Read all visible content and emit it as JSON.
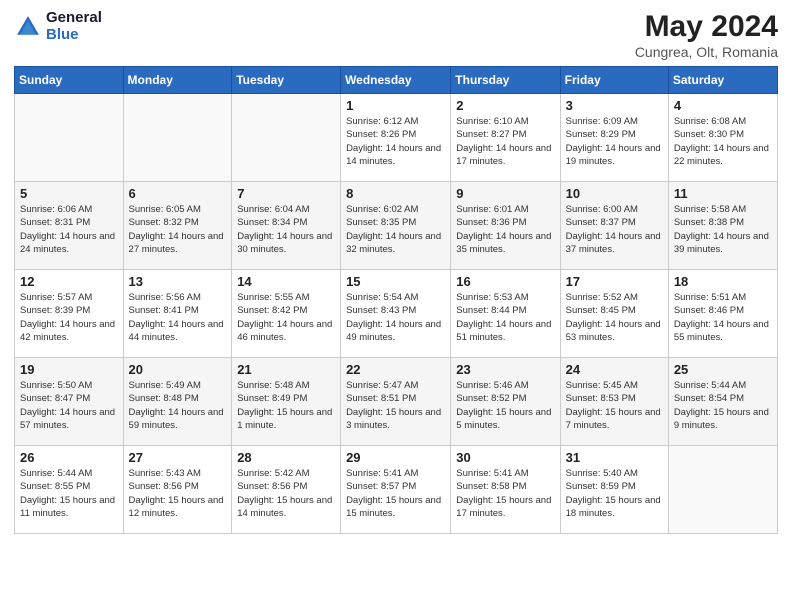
{
  "logo": {
    "general": "General",
    "blue": "Blue"
  },
  "title": "May 2024",
  "subtitle": "Cungrea, Olt, Romania",
  "days_header": [
    "Sunday",
    "Monday",
    "Tuesday",
    "Wednesday",
    "Thursday",
    "Friday",
    "Saturday"
  ],
  "weeks": [
    [
      {
        "day": "",
        "info": ""
      },
      {
        "day": "",
        "info": ""
      },
      {
        "day": "",
        "info": ""
      },
      {
        "day": "1",
        "info": "Sunrise: 6:12 AM\nSunset: 8:26 PM\nDaylight: 14 hours and 14 minutes."
      },
      {
        "day": "2",
        "info": "Sunrise: 6:10 AM\nSunset: 8:27 PM\nDaylight: 14 hours and 17 minutes."
      },
      {
        "day": "3",
        "info": "Sunrise: 6:09 AM\nSunset: 8:29 PM\nDaylight: 14 hours and 19 minutes."
      },
      {
        "day": "4",
        "info": "Sunrise: 6:08 AM\nSunset: 8:30 PM\nDaylight: 14 hours and 22 minutes."
      }
    ],
    [
      {
        "day": "5",
        "info": "Sunrise: 6:06 AM\nSunset: 8:31 PM\nDaylight: 14 hours and 24 minutes."
      },
      {
        "day": "6",
        "info": "Sunrise: 6:05 AM\nSunset: 8:32 PM\nDaylight: 14 hours and 27 minutes."
      },
      {
        "day": "7",
        "info": "Sunrise: 6:04 AM\nSunset: 8:34 PM\nDaylight: 14 hours and 30 minutes."
      },
      {
        "day": "8",
        "info": "Sunrise: 6:02 AM\nSunset: 8:35 PM\nDaylight: 14 hours and 32 minutes."
      },
      {
        "day": "9",
        "info": "Sunrise: 6:01 AM\nSunset: 8:36 PM\nDaylight: 14 hours and 35 minutes."
      },
      {
        "day": "10",
        "info": "Sunrise: 6:00 AM\nSunset: 8:37 PM\nDaylight: 14 hours and 37 minutes."
      },
      {
        "day": "11",
        "info": "Sunrise: 5:58 AM\nSunset: 8:38 PM\nDaylight: 14 hours and 39 minutes."
      }
    ],
    [
      {
        "day": "12",
        "info": "Sunrise: 5:57 AM\nSunset: 8:39 PM\nDaylight: 14 hours and 42 minutes."
      },
      {
        "day": "13",
        "info": "Sunrise: 5:56 AM\nSunset: 8:41 PM\nDaylight: 14 hours and 44 minutes."
      },
      {
        "day": "14",
        "info": "Sunrise: 5:55 AM\nSunset: 8:42 PM\nDaylight: 14 hours and 46 minutes."
      },
      {
        "day": "15",
        "info": "Sunrise: 5:54 AM\nSunset: 8:43 PM\nDaylight: 14 hours and 49 minutes."
      },
      {
        "day": "16",
        "info": "Sunrise: 5:53 AM\nSunset: 8:44 PM\nDaylight: 14 hours and 51 minutes."
      },
      {
        "day": "17",
        "info": "Sunrise: 5:52 AM\nSunset: 8:45 PM\nDaylight: 14 hours and 53 minutes."
      },
      {
        "day": "18",
        "info": "Sunrise: 5:51 AM\nSunset: 8:46 PM\nDaylight: 14 hours and 55 minutes."
      }
    ],
    [
      {
        "day": "19",
        "info": "Sunrise: 5:50 AM\nSunset: 8:47 PM\nDaylight: 14 hours and 57 minutes."
      },
      {
        "day": "20",
        "info": "Sunrise: 5:49 AM\nSunset: 8:48 PM\nDaylight: 14 hours and 59 minutes."
      },
      {
        "day": "21",
        "info": "Sunrise: 5:48 AM\nSunset: 8:49 PM\nDaylight: 15 hours and 1 minute."
      },
      {
        "day": "22",
        "info": "Sunrise: 5:47 AM\nSunset: 8:51 PM\nDaylight: 15 hours and 3 minutes."
      },
      {
        "day": "23",
        "info": "Sunrise: 5:46 AM\nSunset: 8:52 PM\nDaylight: 15 hours and 5 minutes."
      },
      {
        "day": "24",
        "info": "Sunrise: 5:45 AM\nSunset: 8:53 PM\nDaylight: 15 hours and 7 minutes."
      },
      {
        "day": "25",
        "info": "Sunrise: 5:44 AM\nSunset: 8:54 PM\nDaylight: 15 hours and 9 minutes."
      }
    ],
    [
      {
        "day": "26",
        "info": "Sunrise: 5:44 AM\nSunset: 8:55 PM\nDaylight: 15 hours and 11 minutes."
      },
      {
        "day": "27",
        "info": "Sunrise: 5:43 AM\nSunset: 8:56 PM\nDaylight: 15 hours and 12 minutes."
      },
      {
        "day": "28",
        "info": "Sunrise: 5:42 AM\nSunset: 8:56 PM\nDaylight: 15 hours and 14 minutes."
      },
      {
        "day": "29",
        "info": "Sunrise: 5:41 AM\nSunset: 8:57 PM\nDaylight: 15 hours and 15 minutes."
      },
      {
        "day": "30",
        "info": "Sunrise: 5:41 AM\nSunset: 8:58 PM\nDaylight: 15 hours and 17 minutes."
      },
      {
        "day": "31",
        "info": "Sunrise: 5:40 AM\nSunset: 8:59 PM\nDaylight: 15 hours and 18 minutes."
      },
      {
        "day": "",
        "info": ""
      }
    ]
  ]
}
